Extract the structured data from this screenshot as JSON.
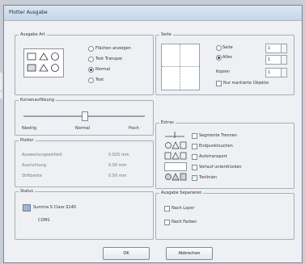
{
  "window": {
    "title": "Plotter Ausgabe"
  },
  "groups": {
    "ausgabe_art": {
      "label": "Ausgabe Art",
      "options": [
        "Flächen anzeigen",
        "Text Transpar.",
        "Normal",
        "Text"
      ],
      "selected_index": 2
    },
    "seite": {
      "label": "Seite",
      "options": [
        "Seite",
        "Alles"
      ],
      "selected_index": 1,
      "fields": [
        "1",
        "1"
      ],
      "kopien_label": "Kopien",
      "kopien_value": "1",
      "nur_markierte": "Nur markierte Objekte"
    },
    "kurvenauflosung": {
      "label": "Kurvenauflösung",
      "labels": [
        "Niedrig",
        "Normal",
        "Hoch"
      ],
      "value_percent": 50
    },
    "plotter": {
      "label": "Plotter",
      "rows": [
        {
          "label": "Auswertungseinheit",
          "value": "0.025 mm"
        },
        {
          "label": "Ausrichtung",
          "value": "0.00 mm"
        },
        {
          "label": "Stiftbreite",
          "value": "0.50 mm"
        }
      ]
    },
    "status": {
      "label": "Status",
      "device": "Summa S Class S140",
      "connection": "COM1"
    },
    "extras": {
      "label": "Extras",
      "options": [
        {
          "label": "Segmente Trennen",
          "checked": false
        },
        {
          "label": "Endpunktsuchen",
          "checked": false
        },
        {
          "label": "Autotransport",
          "checked": false
        },
        {
          "label": "Vorlauf unterdrücken",
          "checked": false
        },
        {
          "label": "Tonlinien",
          "checked": true
        }
      ]
    },
    "ausgabe_sep": {
      "label": "Ausgabe Separieren",
      "options": [
        "Nach Layer",
        "Nach Farben"
      ]
    }
  },
  "buttons": {
    "ok": "OK",
    "cancel": "Abbrechen"
  }
}
